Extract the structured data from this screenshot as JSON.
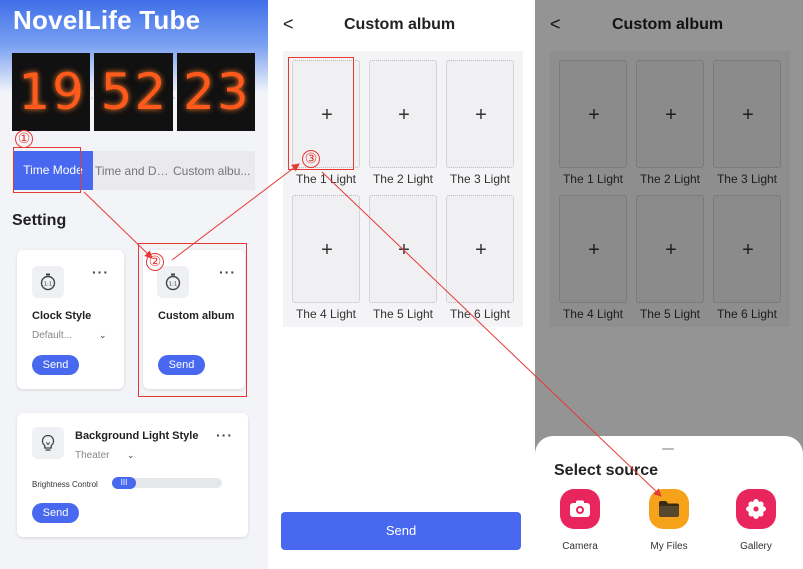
{
  "panel1": {
    "app_title": "NovelLife Tube",
    "clock_digits": [
      "1",
      "9",
      "5",
      "2",
      "2",
      "3"
    ],
    "clock_separator": ":",
    "tabs": [
      "Time Mode",
      "Time and Da...",
      "Custom albu..."
    ],
    "setting_title": "Setting",
    "card_clock": {
      "title": "Clock Style",
      "dropdown": "Default...",
      "send": "Send",
      "more": "···"
    },
    "card_album": {
      "title": "Custom album",
      "send": "Send",
      "more": "···"
    },
    "card_bg": {
      "title": "Background Light Style",
      "dropdown": "Theater",
      "brightness_label": "Brightness Control",
      "brightness_knob": "III",
      "send": "Send",
      "more": "···"
    }
  },
  "panel2": {
    "back": "<",
    "title": "Custom album",
    "cells": [
      "The 1 Light",
      "The 2 Light",
      "The 3 Light",
      "The 4 Light",
      "The 5 Light",
      "The 6 Light"
    ],
    "plus": "+",
    "send": "Send"
  },
  "panel3": {
    "back": "<",
    "title": "Custom album",
    "cells": [
      "The 1 Light",
      "The 2 Light",
      "The 3 Light",
      "The 4 Light",
      "The 5 Light",
      "The 6 Light"
    ],
    "plus": "+",
    "sheet_title": "Select source",
    "sources": [
      {
        "label": "Camera",
        "icon": "camera-icon",
        "color": "#e8255c"
      },
      {
        "label": "My Files",
        "icon": "folder-icon",
        "color": "#f7a21b"
      },
      {
        "label": "Gallery",
        "icon": "flower-icon",
        "color": "#e8255c"
      }
    ]
  },
  "annotations": [
    "①",
    "②",
    "③"
  ],
  "colors": {
    "accent": "#4768ef",
    "annotation": "#e53935",
    "nixie": "#ff5a1c"
  }
}
